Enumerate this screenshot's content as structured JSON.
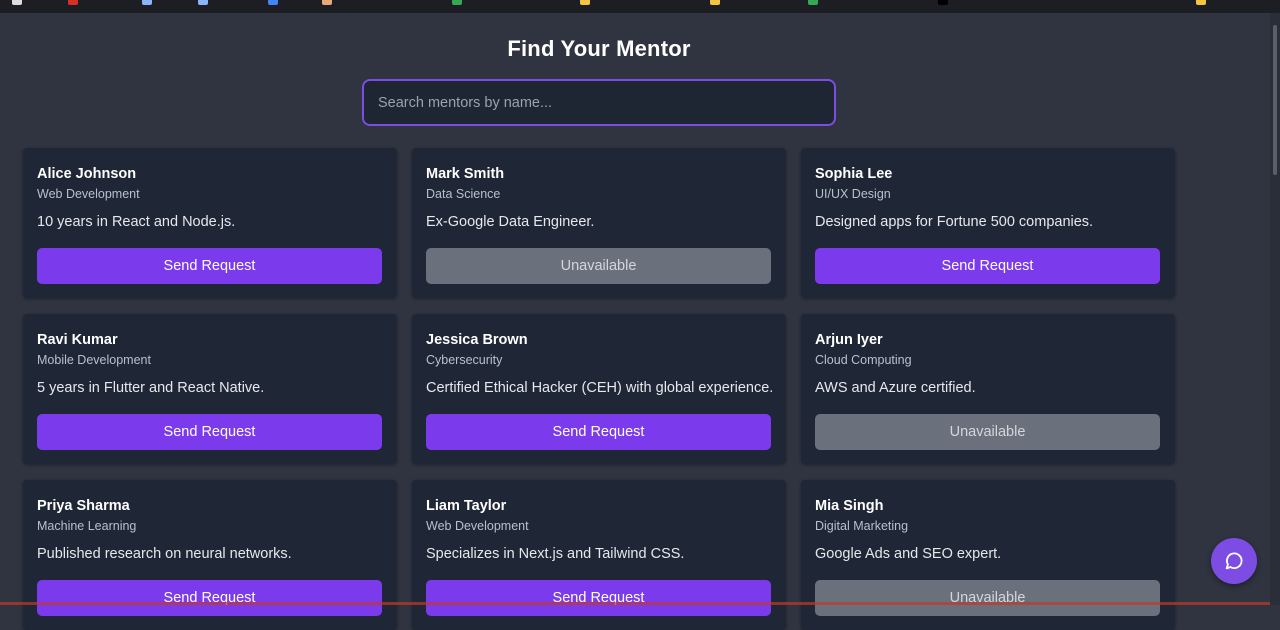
{
  "header": {
    "title": "Find Your Mentor"
  },
  "search": {
    "placeholder": "Search mentors by name...",
    "value": ""
  },
  "colors": {
    "accent": "#7c3aed",
    "unavailable": "#6b717c",
    "card_bg": "#1f2635",
    "page_bg": "#2f3440"
  },
  "mentors": [
    {
      "name": "Alice Johnson",
      "field": "Web Development",
      "description": "10 years in React and Node.js.",
      "button": "Send Request",
      "available": true
    },
    {
      "name": "Mark Smith",
      "field": "Data Science",
      "description": "Ex-Google Data Engineer.",
      "button": "Unavailable",
      "available": false
    },
    {
      "name": "Sophia Lee",
      "field": "UI/UX Design",
      "description": "Designed apps for Fortune 500 companies.",
      "button": "Send Request",
      "available": true
    },
    {
      "name": "Ravi Kumar",
      "field": "Mobile Development",
      "description": "5 years in Flutter and React Native.",
      "button": "Send Request",
      "available": true
    },
    {
      "name": "Jessica Brown",
      "field": "Cybersecurity",
      "description": "Certified Ethical Hacker (CEH) with global experience.",
      "button": "Send Request",
      "available": true
    },
    {
      "name": "Arjun Iyer",
      "field": "Cloud Computing",
      "description": "AWS and Azure certified.",
      "button": "Unavailable",
      "available": false
    },
    {
      "name": "Priya Sharma",
      "field": "Machine Learning",
      "description": "Published research on neural networks.",
      "button": "Send Request",
      "available": true
    },
    {
      "name": "Liam Taylor",
      "field": "Web Development",
      "description": "Specializes in Next.js and Tailwind CSS.",
      "button": "Send Request",
      "available": true
    },
    {
      "name": "Mia Singh",
      "field": "Digital Marketing",
      "description": "Google Ads and SEO expert.",
      "button": "Unavailable",
      "available": false
    }
  ],
  "chat_widget": {
    "icon": "chat-bubble-icon"
  }
}
